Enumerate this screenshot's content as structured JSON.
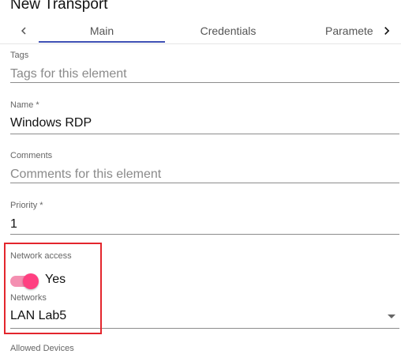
{
  "dialog": {
    "title": "New Transport"
  },
  "tabs": [
    {
      "label": "Main",
      "active": true
    },
    {
      "label": "Credentials",
      "active": false
    },
    {
      "label": "Parameters",
      "active": false
    }
  ],
  "icons": {
    "prev": "chevron-left-icon",
    "next": "chevron-right-icon",
    "dropdown": "caret-down-icon"
  },
  "fields": {
    "tags": {
      "label": "Tags",
      "value": "",
      "placeholder": "Tags for this element"
    },
    "name": {
      "label": "Name *",
      "value": "Windows RDP"
    },
    "comments": {
      "label": "Comments",
      "value": "",
      "placeholder": "Comments for this element"
    },
    "priority": {
      "label": "Priority *",
      "value": "1"
    },
    "network_access": {
      "label": "Network access",
      "value": "Yes",
      "checked": true
    },
    "networks": {
      "label": "Networks",
      "value": "LAN Lab5"
    },
    "allowed_devices": {
      "label": "Allowed Devices"
    }
  },
  "colors": {
    "tab_ink": "#3f51b5",
    "toggle_thumb": "#ff4081",
    "toggle_track": "#f48fb1",
    "highlight": "#e3262d"
  }
}
